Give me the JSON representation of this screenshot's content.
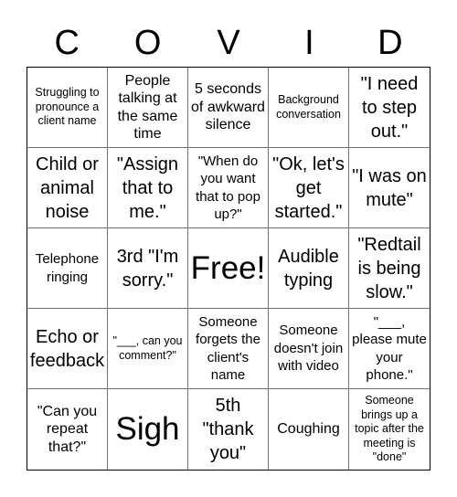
{
  "header": {
    "letters": [
      "C",
      "O",
      "V",
      "I",
      "D"
    ]
  },
  "board": {
    "rows": [
      [
        "Struggling to pronounce a client name",
        "People talking at the same time",
        "5 seconds of awkward silence",
        "Background conversation",
        "\"I need to step out.\""
      ],
      [
        "Child or animal noise",
        "\"Assign that to me.\"",
        "\"When do you want that to pop up?\"",
        "\"Ok, let's get started.\"",
        "\"I was on mute\""
      ],
      [
        "Telephone ringing",
        "3rd \"I'm sorry.\"",
        "Free!",
        "Audible typing",
        "\"Redtail is being slow.\""
      ],
      [
        "Echo or feedback",
        "\"___, can you comment?\"",
        "Someone forgets the client's name",
        "Someone doesn't join with video",
        "\"___, please mute your phone.\""
      ],
      [
        "\"Can you repeat that?\"",
        "Sigh",
        "5th \"thank you\"",
        "Coughing",
        "Someone brings up a topic after the meeting is \"done\""
      ]
    ],
    "free_space": "Free!"
  }
}
